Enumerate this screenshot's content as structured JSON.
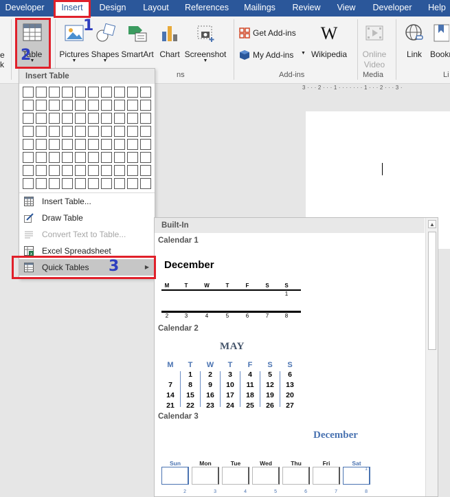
{
  "tabs": [
    "Developer",
    "Insert",
    "Design",
    "Layout",
    "References",
    "Mailings",
    "Review",
    "View",
    "Developer",
    "Help"
  ],
  "steps": [
    "1",
    "2",
    "3"
  ],
  "ribbon": {
    "left_fragments": [
      "e",
      "k"
    ],
    "table_label": "Table",
    "pictures_label": "Pictures",
    "shapes_label": "Shapes",
    "smartart_label": "SmartArt",
    "chart_label": "Chart",
    "screenshot_label": "Screenshot",
    "get_addins_label": "Get Add-ins",
    "my_addins_label": "My Add-ins",
    "wikipedia_label": "Wikipedia",
    "online_video_line1": "Online",
    "online_video_line2": "Video",
    "link_label": "Link",
    "bookmark_label": "Bookm",
    "group_illustrations_fragment": "ns",
    "group_addins": "Add-ins",
    "group_media": "Media",
    "group_links_fragment": "Li"
  },
  "ruler_text": "3 · · · 2 · · · 1 · · · · · · · 1 · · · 2 · · · 3 ·",
  "insert_table": {
    "header": "Insert Table",
    "grid_cols": 10,
    "grid_rows": 8,
    "menu": [
      {
        "label": "Insert Table...",
        "disabled": false,
        "icon": "table-icon"
      },
      {
        "label": "Draw Table",
        "disabled": false,
        "icon": "draw-pencil-icon"
      },
      {
        "label": "Convert Text to Table...",
        "disabled": true,
        "icon": "convert-text-icon"
      },
      {
        "label": "Excel Spreadsheet",
        "disabled": false,
        "icon": "excel-icon"
      },
      {
        "label": "Quick Tables",
        "disabled": false,
        "icon": "quick-tables-icon"
      }
    ]
  },
  "gallery": {
    "header": "Built-In",
    "calendar1": {
      "label": "Calendar 1",
      "month": "December",
      "days": [
        "M",
        "T",
        "W",
        "T",
        "F",
        "S",
        "S"
      ],
      "row1": [
        "",
        "",
        "",
        "",
        "",
        "",
        "1"
      ],
      "row2": [
        "2",
        "3",
        "4",
        "5",
        "6",
        "7",
        "8"
      ]
    },
    "calendar2": {
      "label": "Calendar 2",
      "month": "MAY",
      "days": [
        "M",
        "T",
        "W",
        "T",
        "F",
        "S",
        "S"
      ],
      "weeks": [
        [
          "",
          "1",
          "2",
          "3",
          "4",
          "5",
          "6"
        ],
        [
          "7",
          "8",
          "9",
          "10",
          "11",
          "12",
          "13"
        ],
        [
          "14",
          "15",
          "16",
          "17",
          "18",
          "19",
          "20"
        ],
        [
          "21",
          "22",
          "23",
          "24",
          "25",
          "26",
          "27"
        ]
      ]
    },
    "calendar3": {
      "label": "Calendar 3",
      "month": "December",
      "days": [
        "Sun",
        "Mon",
        "Tue",
        "Wed",
        "Thu",
        "Fri",
        "Sat"
      ],
      "row1": [
        "",
        "",
        "",
        "",
        "",
        "",
        "1"
      ],
      "row2": [
        "2",
        "3",
        "4",
        "5",
        "6",
        "7",
        "8"
      ]
    }
  }
}
